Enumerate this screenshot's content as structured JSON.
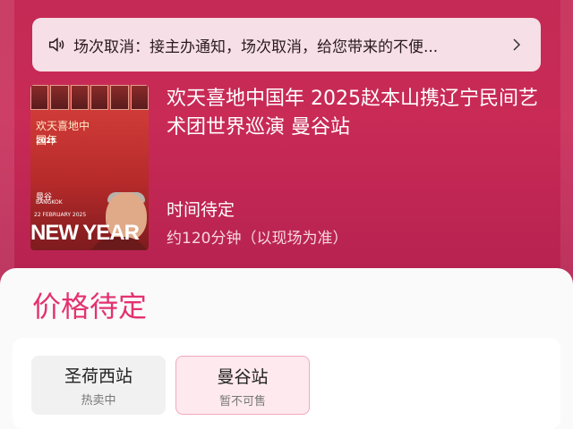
{
  "notice": {
    "text": "场次取消：接主办通知，场次取消，给您带来的不便..."
  },
  "event": {
    "title": "欢天喜地中国年 2025赵本山携辽宁民间艺术团世界巡演 曼谷站",
    "time": "时间待定",
    "duration": "约120分钟（以现场为准）"
  },
  "poster": {
    "calligraphy": "欢天喜地中国年",
    "year": "2025",
    "city": "曼谷",
    "city_en": "BANGKOK",
    "date": "22 FEBRUARY 2025",
    "banner": "NEW YEAR"
  },
  "price": "价格待定",
  "stations": [
    {
      "name": "圣荷西站",
      "status": "热卖中"
    },
    {
      "name": "曼谷站",
      "status": "暂不可售"
    }
  ],
  "colors": {
    "accent": "#e3326f",
    "hero": "#c42a55"
  }
}
